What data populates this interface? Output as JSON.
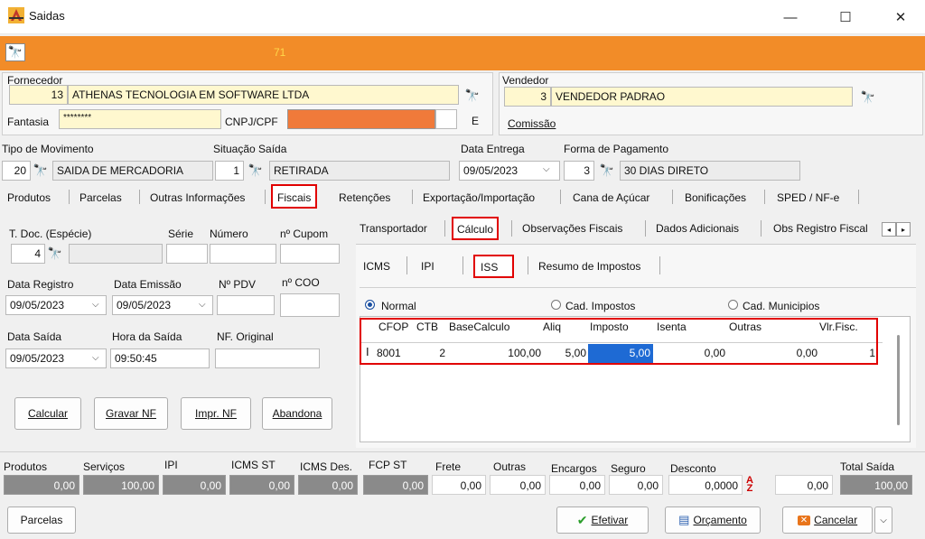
{
  "window": {
    "title": "Saidas",
    "minimize": "—",
    "maximize": "☐",
    "close": "✕"
  },
  "toolbar": {
    "number": "71"
  },
  "supplier": {
    "label": "Fornecedor",
    "code": "13",
    "name": "ATHENAS TECNOLOGIA EM SOFTWARE LTDA",
    "fantasia_label": "Fantasia",
    "fantasia_value": "********",
    "cnpj_label": "CNPJ/CPF",
    "e_label": "E"
  },
  "seller": {
    "label": "Vendedor",
    "code": "3",
    "name": "VENDEDOR PADRAO",
    "commission_label": "Comissão"
  },
  "movement": {
    "tipo_label": "Tipo de Movimento",
    "tipo_code": "20",
    "tipo_value": "SAIDA DE MERCADORIA",
    "situacao_label": "Situação Saída",
    "situacao_code": "1",
    "situacao_value": "RETIRADA",
    "entrega_label": "Data Entrega",
    "entrega_value": "09/05/2023",
    "pagamento_label": "Forma de Pagamento",
    "pagamento_code": "3",
    "pagamento_value": "30 DIAS DIRETO"
  },
  "main_tabs": [
    "Produtos",
    "Parcelas",
    "Outras Informações",
    "Fiscais",
    "Retenções",
    "Exportação/Importação",
    "Cana de Açúcar",
    "Bonificações",
    "SPED / NF-e"
  ],
  "left": {
    "tdoc_label": "T. Doc. (Espécie)",
    "tdoc_value": "4",
    "serie_label": "Série",
    "numero_label": "Número",
    "cupom_label": "nº Cupom",
    "registro_label": "Data Registro",
    "registro_value": "09/05/2023",
    "emissao_label": "Data Emissão",
    "emissao_value": "09/05/2023",
    "pdv_label": "Nº PDV",
    "coo_label": "nº COO",
    "saida_label": "Data Saída",
    "saida_value": "09/05/2023",
    "hora_label": "Hora da Saída",
    "hora_value": "09:50:45",
    "original_label": "NF. Original",
    "btn_calcular": "Calcular",
    "btn_gravar": "Gravar NF",
    "btn_impr": "Impr. NF",
    "btn_abandona": "Abandona"
  },
  "fiscal_tabs": [
    "Transportador",
    "Cálculo",
    "Observações Fiscais",
    "Dados Adicionais",
    "Obs Registro Fiscal"
  ],
  "calc_tabs": [
    "ICMS",
    "IPI",
    "ISS",
    "Resumo de Impostos"
  ],
  "radios": {
    "normal": "Normal",
    "impostos": "Cad. Impostos",
    "municipios": "Cad. Municipios"
  },
  "iss_table": {
    "columns": [
      "CFOP",
      "CTB",
      "BaseCalculo",
      "Aliq",
      "Imposto",
      "Isenta",
      "Outras",
      "Vlr.Fisc."
    ],
    "row": {
      "cfop": "8001",
      "ctb": "2",
      "base": "100,00",
      "aliq": "5,00",
      "imposto": "5,00",
      "isenta": "0,00",
      "outras": "0,00",
      "vlrfisc": "1"
    }
  },
  "totals": {
    "produtos_label": "Produtos",
    "produtos": "0,00",
    "servicos_label": "Serviços",
    "servicos": "100,00",
    "ipi_label": "IPI",
    "ipi": "0,00",
    "icmsst_label": "ICMS ST",
    "icmsst": "0,00",
    "icmsdes_label": "ICMS Des.",
    "icmsdes": "0,00",
    "fcpst_label": "FCP ST",
    "fcpst": "0,00",
    "frete_label": "Frete",
    "frete": "0,00",
    "outras_label": "Outras",
    "outras": "0,00",
    "encargos_label": "Encargos",
    "encargos": "0,00",
    "seguro_label": "Seguro",
    "seguro": "0,00",
    "desconto_label": "Desconto",
    "desconto_pct": "0,0000",
    "desconto": "0,00",
    "total_label": "Total Saída",
    "total": "100,00"
  },
  "footer": {
    "parcelas": "Parcelas",
    "efetivar": "Efetivar",
    "orcamento": "Orçamento",
    "cancelar": "Cancelar"
  }
}
